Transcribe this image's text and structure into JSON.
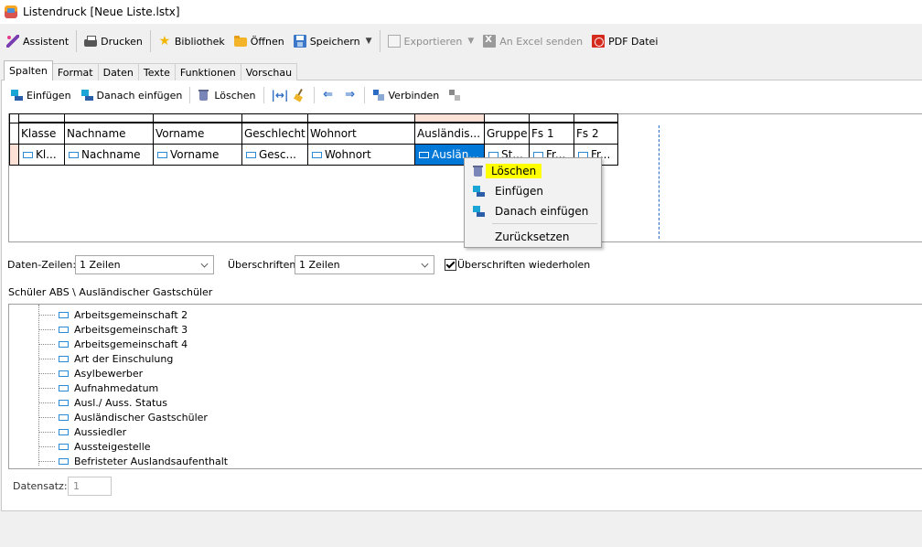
{
  "window": {
    "title": "Listendruck [Neue Liste.lstx]"
  },
  "toolbar": {
    "assistent": "Assistent",
    "drucken": "Drucken",
    "bibliothek": "Bibliothek",
    "oeffnen": "Öffnen",
    "speichern": "Speichern",
    "exportieren": "Exportieren",
    "excel": "An Excel senden",
    "pdf": "PDF Datei"
  },
  "tabs": [
    "Spalten",
    "Format",
    "Daten",
    "Texte",
    "Funktionen",
    "Vorschau"
  ],
  "active_tab": "Spalten",
  "subtoolbar": {
    "einfuegen": "Einfügen",
    "danach_einfuegen": "Danach einfügen",
    "loeschen": "Löschen",
    "verbinden": "Verbinden"
  },
  "columns": [
    {
      "header": "Klasse",
      "cell": "Kl..."
    },
    {
      "header": "Nachname",
      "cell": "Nachname"
    },
    {
      "header": "Vorname",
      "cell": "Vorname"
    },
    {
      "header": "Geschlecht",
      "cell": "Gesc..."
    },
    {
      "header": "Wohnort",
      "cell": "Wohnort"
    },
    {
      "header": "Ausländis...",
      "cell": "Auslän..."
    },
    {
      "header": "Gruppe",
      "cell": "St..."
    },
    {
      "header": "Fs 1",
      "cell": "Fr..."
    },
    {
      "header": "Fs 2",
      "cell": "Fr..."
    }
  ],
  "selected_column": 5,
  "context_menu": {
    "items": [
      "Löschen",
      "Einfügen",
      "Danach einfügen",
      "Zurücksetzen"
    ],
    "highlighted": "Löschen",
    "icons": [
      "trash-icon",
      "insert-column-icon",
      "insert-column-after-icon"
    ]
  },
  "options": {
    "daten_zeilen_label": "Daten-Zeilen:",
    "daten_zeilen_value": "1 Zeilen",
    "ueberschriften_label": "Überschriften:",
    "ueberschriften_value": "1 Zeilen",
    "wiederholen_label": "Überschriften wiederholen",
    "wiederholen_checked": true
  },
  "breadcrumb": "Schüler ABS \\ Ausländischer Gastschüler",
  "tree_items": [
    "Arbeitsgemeinschaft 2",
    "Arbeitsgemeinschaft 3",
    "Arbeitsgemeinschaft 4",
    "Art der Einschulung",
    "Asylbewerber",
    "Aufnahmedatum",
    "Ausl./ Auss. Status",
    "Ausländischer Gastschüler",
    "Aussiedler",
    "Aussteigestelle",
    "Befristeter Auslandsaufenthalt"
  ],
  "datensatz": {
    "label": "Datensatz:",
    "value": "1"
  },
  "colors": {
    "selection": "#0078d7",
    "highlight": "#ffff00",
    "accent": "#2b6bc4"
  }
}
